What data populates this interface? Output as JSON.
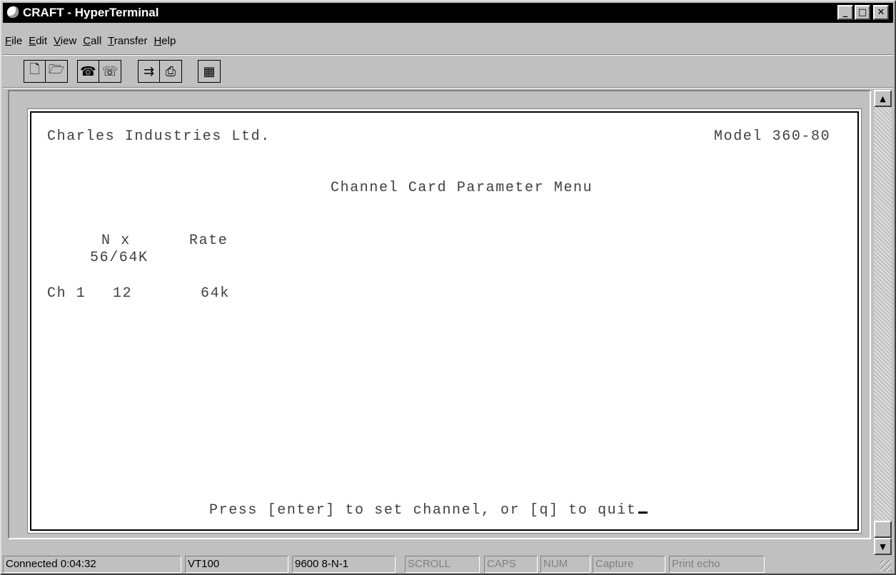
{
  "window": {
    "title": "CRAFT - HyperTerminal",
    "controls": {
      "minimize": "_",
      "maximize": "□",
      "close": "✕"
    }
  },
  "menu": {
    "items": [
      {
        "label": "File",
        "accel": "F",
        "rest": "ile"
      },
      {
        "label": "Edit",
        "accel": "E",
        "rest": "dit"
      },
      {
        "label": "View",
        "accel": "V",
        "rest": "iew"
      },
      {
        "label": "Call",
        "accel": "C",
        "rest": "all"
      },
      {
        "label": "Transfer",
        "accel": "T",
        "rest": "ransfer"
      },
      {
        "label": "Help",
        "accel": "H",
        "rest": "elp"
      }
    ]
  },
  "toolbar": {
    "buttons": [
      {
        "name": "new-icon",
        "glyph": "🗋"
      },
      {
        "name": "open-folder-icon",
        "glyph": "🗁"
      },
      {
        "name": "call-phone-icon",
        "glyph": "☎"
      },
      {
        "name": "disconnect-icon",
        "glyph": "☏"
      },
      {
        "name": "send-file-icon",
        "glyph": "⇉"
      },
      {
        "name": "receive-file-icon",
        "glyph": "⎙"
      },
      {
        "name": "properties-icon",
        "glyph": "▦"
      }
    ]
  },
  "terminal": {
    "company": "Charles Industries Ltd.",
    "model": "Model 360-80",
    "menu_title": "Channel Card Parameter Menu",
    "header_nx": "N x",
    "header_rate": "Rate",
    "header_nx_sub": "56/64K",
    "row": {
      "channel": "Ch 1",
      "nx": "12",
      "rate": "64k"
    },
    "prompt": "Press [enter] to set channel, or [q] to quit"
  },
  "scrollbar": {
    "up": "▲",
    "down": "▼"
  },
  "status": {
    "connected": "Connected 0:04:32",
    "emulation": "VT100",
    "settings": "9600 8-N-1",
    "scroll": "SCROLL",
    "caps": "CAPS",
    "num": "NUM",
    "capture": "Capture",
    "print_echo": "Print echo"
  }
}
